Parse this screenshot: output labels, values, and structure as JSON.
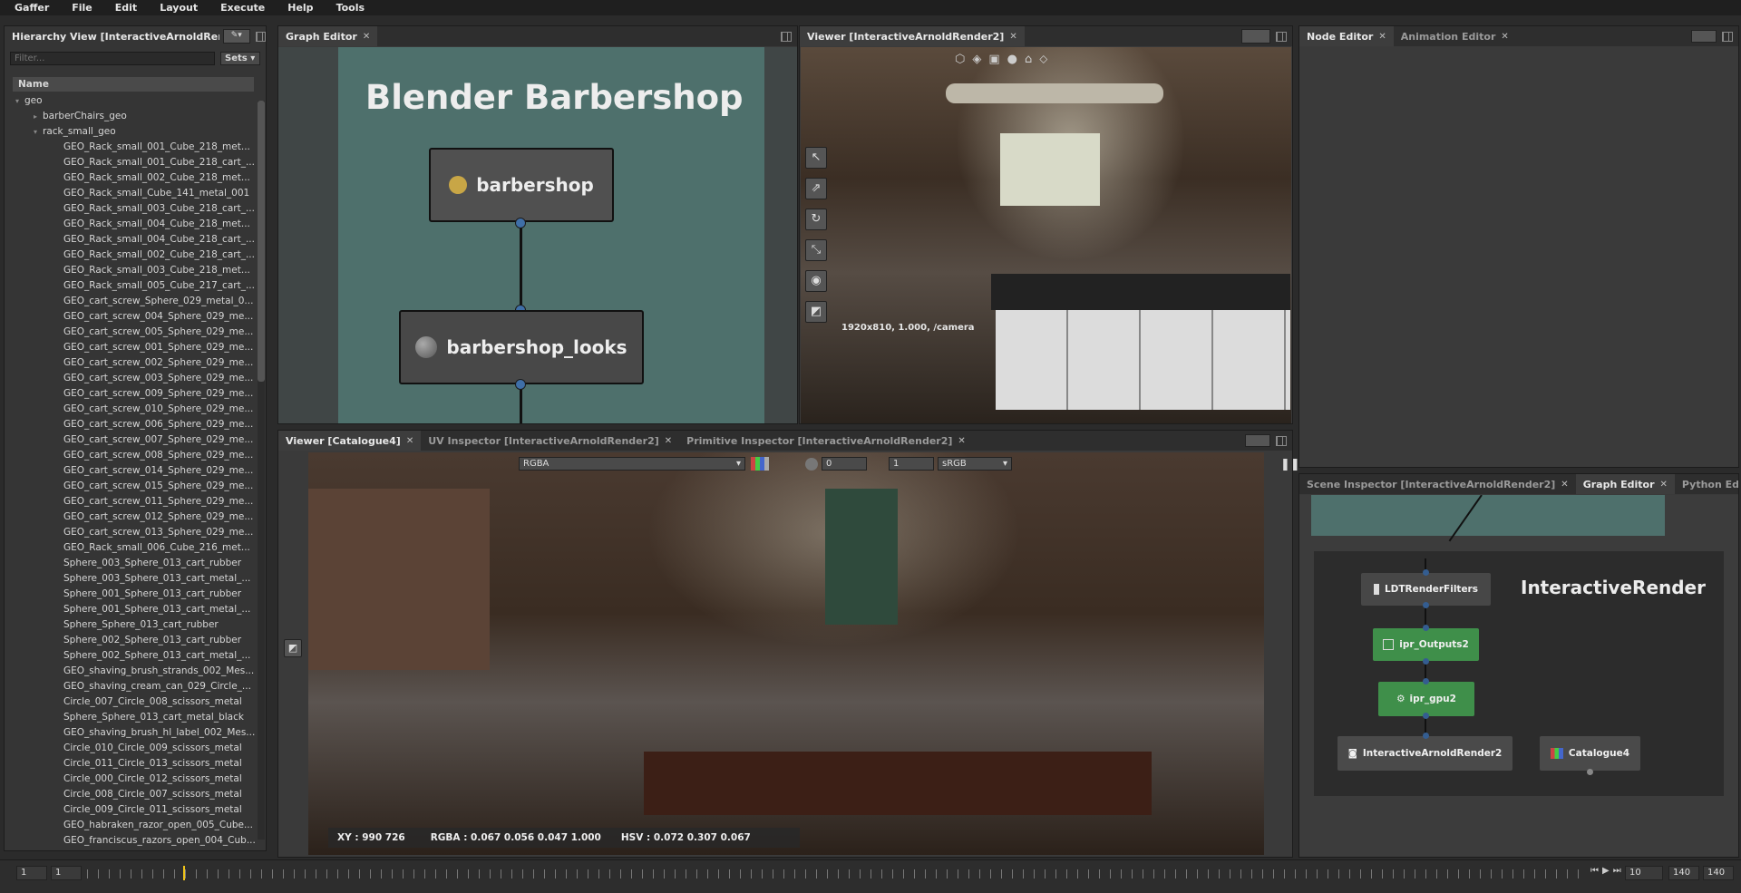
{
  "menubar": {
    "items": [
      "Gaffer",
      "File",
      "Edit",
      "Layout",
      "Execute",
      "Help",
      "Tools"
    ]
  },
  "hierarchy": {
    "tab_label": "Hierarchy View [InteractiveArnoldRende",
    "filter_placeholder": "Filter...",
    "sets_label": "Sets",
    "column_name": "Name",
    "rows": [
      {
        "label": "geo",
        "indent": 0,
        "arrow": "▾"
      },
      {
        "label": "barberChairs_geo",
        "indent": 1,
        "arrow": "▸"
      },
      {
        "label": "rack_small_geo",
        "indent": 1,
        "arrow": "▾"
      },
      {
        "label": "GEO_Rack_small_001_Cube_218_met...",
        "indent": 2,
        "arrow": ""
      },
      {
        "label": "GEO_Rack_small_001_Cube_218_cart_...",
        "indent": 2,
        "arrow": ""
      },
      {
        "label": "GEO_Rack_small_002_Cube_218_met...",
        "indent": 2,
        "arrow": ""
      },
      {
        "label": "GEO_Rack_small_Cube_141_metal_001",
        "indent": 2,
        "arrow": ""
      },
      {
        "label": "GEO_Rack_small_003_Cube_218_cart_...",
        "indent": 2,
        "arrow": ""
      },
      {
        "label": "GEO_Rack_small_004_Cube_218_met...",
        "indent": 2,
        "arrow": ""
      },
      {
        "label": "GEO_Rack_small_004_Cube_218_cart_...",
        "indent": 2,
        "arrow": ""
      },
      {
        "label": "GEO_Rack_small_002_Cube_218_cart_...",
        "indent": 2,
        "arrow": ""
      },
      {
        "label": "GEO_Rack_small_003_Cube_218_met...",
        "indent": 2,
        "arrow": ""
      },
      {
        "label": "GEO_Rack_small_005_Cube_217_cart_...",
        "indent": 2,
        "arrow": ""
      },
      {
        "label": "GEO_cart_screw_Sphere_029_metal_0...",
        "indent": 2,
        "arrow": ""
      },
      {
        "label": "GEO_cart_screw_004_Sphere_029_me...",
        "indent": 2,
        "arrow": ""
      },
      {
        "label": "GEO_cart_screw_005_Sphere_029_me...",
        "indent": 2,
        "arrow": ""
      },
      {
        "label": "GEO_cart_screw_001_Sphere_029_me...",
        "indent": 2,
        "arrow": ""
      },
      {
        "label": "GEO_cart_screw_002_Sphere_029_me...",
        "indent": 2,
        "arrow": ""
      },
      {
        "label": "GEO_cart_screw_003_Sphere_029_me...",
        "indent": 2,
        "arrow": ""
      },
      {
        "label": "GEO_cart_screw_009_Sphere_029_me...",
        "indent": 2,
        "arrow": ""
      },
      {
        "label": "GEO_cart_screw_010_Sphere_029_me...",
        "indent": 2,
        "arrow": ""
      },
      {
        "label": "GEO_cart_screw_006_Sphere_029_me...",
        "indent": 2,
        "arrow": ""
      },
      {
        "label": "GEO_cart_screw_007_Sphere_029_me...",
        "indent": 2,
        "arrow": ""
      },
      {
        "label": "GEO_cart_screw_008_Sphere_029_me...",
        "indent": 2,
        "arrow": ""
      },
      {
        "label": "GEO_cart_screw_014_Sphere_029_me...",
        "indent": 2,
        "arrow": ""
      },
      {
        "label": "GEO_cart_screw_015_Sphere_029_me...",
        "indent": 2,
        "arrow": ""
      },
      {
        "label": "GEO_cart_screw_011_Sphere_029_me...",
        "indent": 2,
        "arrow": ""
      },
      {
        "label": "GEO_cart_screw_012_Sphere_029_me...",
        "indent": 2,
        "arrow": ""
      },
      {
        "label": "GEO_cart_screw_013_Sphere_029_me...",
        "indent": 2,
        "arrow": ""
      },
      {
        "label": "GEO_Rack_small_006_Cube_216_met...",
        "indent": 2,
        "arrow": ""
      },
      {
        "label": "Sphere_003_Sphere_013_cart_rubber",
        "indent": 2,
        "arrow": ""
      },
      {
        "label": "Sphere_003_Sphere_013_cart_metal_...",
        "indent": 2,
        "arrow": ""
      },
      {
        "label": "Sphere_001_Sphere_013_cart_rubber",
        "indent": 2,
        "arrow": ""
      },
      {
        "label": "Sphere_001_Sphere_013_cart_metal_...",
        "indent": 2,
        "arrow": ""
      },
      {
        "label": "Sphere_Sphere_013_cart_rubber",
        "indent": 2,
        "arrow": ""
      },
      {
        "label": "Sphere_002_Sphere_013_cart_rubber",
        "indent": 2,
        "arrow": ""
      },
      {
        "label": "Sphere_002_Sphere_013_cart_metal_...",
        "indent": 2,
        "arrow": ""
      },
      {
        "label": "GEO_shaving_brush_strands_002_Mes...",
        "indent": 2,
        "arrow": ""
      },
      {
        "label": "GEO_shaving_cream_can_029_Circle_...",
        "indent": 2,
        "arrow": ""
      },
      {
        "label": "Circle_007_Circle_008_scissors_metal",
        "indent": 2,
        "arrow": ""
      },
      {
        "label": "Sphere_Sphere_013_cart_metal_black",
        "indent": 2,
        "arrow": ""
      },
      {
        "label": "GEO_shaving_brush_hl_label_002_Mes...",
        "indent": 2,
        "arrow": ""
      },
      {
        "label": "Circle_010_Circle_009_scissors_metal",
        "indent": 2,
        "arrow": ""
      },
      {
        "label": "Circle_011_Circle_013_scissors_metal",
        "indent": 2,
        "arrow": ""
      },
      {
        "label": "Circle_000_Circle_012_scissors_metal",
        "indent": 2,
        "arrow": ""
      },
      {
        "label": "Circle_008_Circle_007_scissors_metal",
        "indent": 2,
        "arrow": ""
      },
      {
        "label": "Circle_009_Circle_011_scissors_metal",
        "indent": 2,
        "arrow": ""
      },
      {
        "label": "GEO_habraken_razor_open_005_Cube...",
        "indent": 2,
        "arrow": ""
      },
      {
        "label": "GEO_franciscus_razors_open_004_Cub...",
        "indent": 2,
        "arrow": ""
      }
    ]
  },
  "graph_editor_top": {
    "tab_label": "Graph Editor",
    "backdrop_title": "Blender Barbershop",
    "nodes": [
      {
        "label": "barbershop"
      },
      {
        "label": "barbershop_looks"
      }
    ]
  },
  "viewer_top": {
    "tab_label": "Viewer [InteractiveArnoldRender2]",
    "overlay_text": "1920x810, 1.000, /camera"
  },
  "node_editor": {
    "tabs": [
      {
        "label": "Node Editor",
        "active": true
      },
      {
        "label": "Animation Editor",
        "active": false
      }
    ]
  },
  "viewer_bottom": {
    "tabs": [
      {
        "label": "Viewer [Catalogue4]",
        "active": true
      },
      {
        "label": "UV Inspector [InteractiveArnoldRender2]",
        "active": false
      },
      {
        "label": "Primitive Inspector [InteractiveArnoldRender2]",
        "active": false
      }
    ],
    "channel_select": "RGBA",
    "exposure_value": "0",
    "gamma_value": "1",
    "colorspace_select": "sRGB",
    "pixel_readout": {
      "xy": "XY : 990 726",
      "rgba": "RGBA : 0.067 0.056 0.047 1.000",
      "hsv": "HSV : 0.072 0.307 0.067"
    }
  },
  "graph_editor_bottom": {
    "tabs": [
      {
        "label": "Scene Inspector [InteractiveArnoldRender2]",
        "active": false
      },
      {
        "label": "Graph Editor",
        "active": true
      },
      {
        "label": "Python Edito",
        "active": false
      }
    ],
    "backdrop_title": "InteractiveRender",
    "nodes": [
      {
        "label": "LDTRenderFilters"
      },
      {
        "label": "ipr_Outputs2"
      },
      {
        "label": "ipr_gpu2"
      },
      {
        "label": "InteractiveArnoldRender2"
      },
      {
        "label": "Catalogue4"
      }
    ]
  },
  "timeline": {
    "start_field": "1",
    "current_field": "1",
    "frame_field": "10",
    "end_field": "140",
    "end_field2": "140",
    "current_frame": 10,
    "range_start": 1,
    "range_end": 140
  },
  "colors": {
    "accent": "#3f6fa8",
    "green_node": "#3f8f4a",
    "backdrop": "#4e706c",
    "playhead": "#f0c419"
  }
}
